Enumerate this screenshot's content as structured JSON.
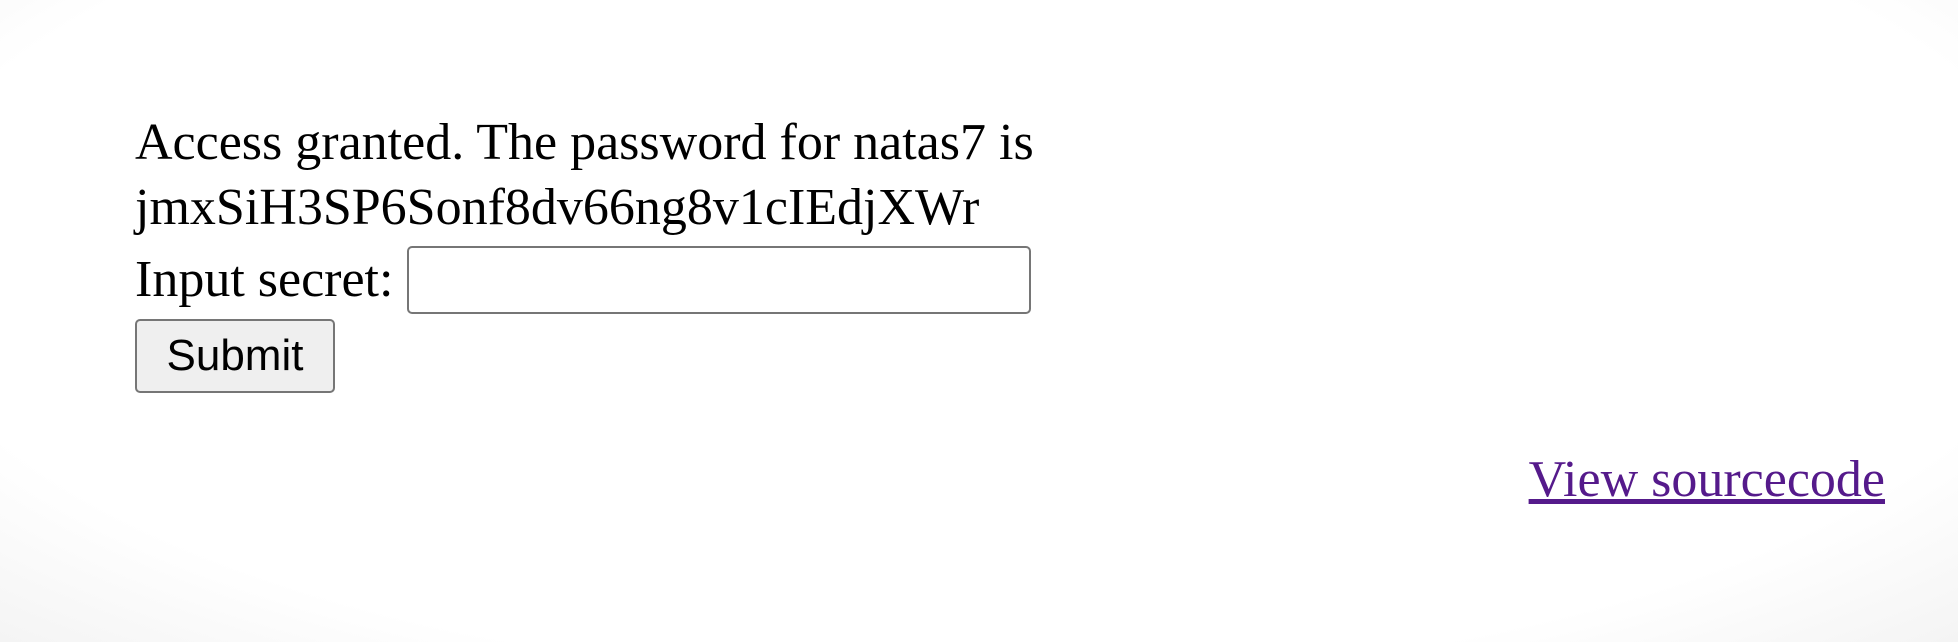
{
  "message": {
    "line1": "Access granted. The password for natas7 is",
    "password": "jmxSiH3SP6Sonf8dv66ng8v1cIEdjXWr"
  },
  "form": {
    "label": "Input secret:",
    "input_value": "",
    "submit_label": "Submit"
  },
  "footer": {
    "view_source_label": "View sourcecode"
  },
  "colors": {
    "link_visited": "#551a8b",
    "button_bg": "#efefef",
    "border": "#767676"
  }
}
